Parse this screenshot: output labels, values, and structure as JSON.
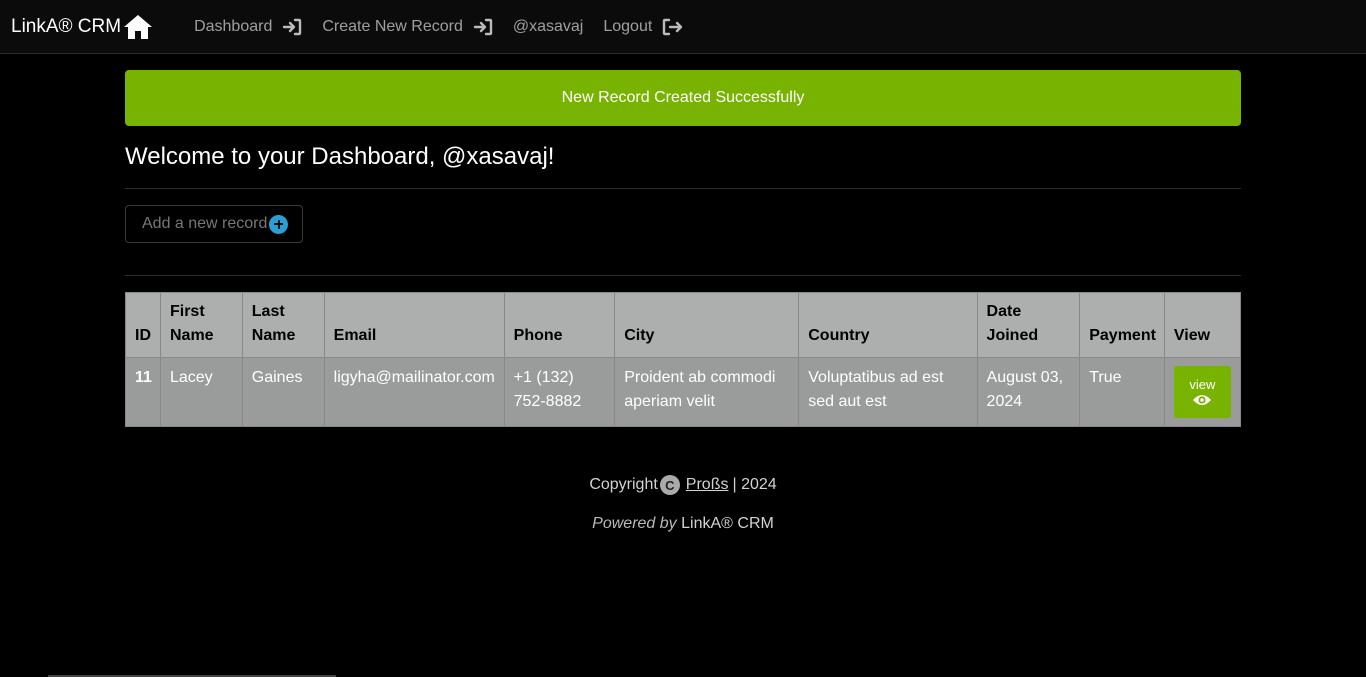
{
  "nav": {
    "brand": "LinkA® CRM",
    "links": [
      {
        "label": "Dashboard"
      },
      {
        "label": "Create New Record"
      },
      {
        "label": "@xasavaj"
      },
      {
        "label": "Logout"
      }
    ]
  },
  "alert": {
    "text": "New Record Created Successfully",
    "color": "#77b300"
  },
  "welcome": "Welcome to your Dashboard, @xasavaj!",
  "add_button": {
    "label": "Add a new record"
  },
  "table": {
    "headers": [
      "ID",
      "First Name",
      "Last Name",
      "Email",
      "Phone",
      "City",
      "Country",
      "Date Joined",
      "Payment",
      "View"
    ],
    "rows": [
      {
        "id": "11",
        "first_name": "Lacey",
        "last_name": "Gaines",
        "email": "ligyha@mailinator.com",
        "phone": "+1 (132) 752-8882",
        "city": "Proident ab commodi aperiam velit",
        "country": "Voluptatibus ad est sed aut est",
        "date_joined": "August 03, 2024",
        "payment": "True",
        "view_label": "view"
      }
    ]
  },
  "footer": {
    "copyright_label": "Copyright",
    "copyright_symbol": "C",
    "author": "Proßs",
    "year": "| 2024",
    "powered_by": "Powered by",
    "powered_name": "LinkA® CRM"
  }
}
